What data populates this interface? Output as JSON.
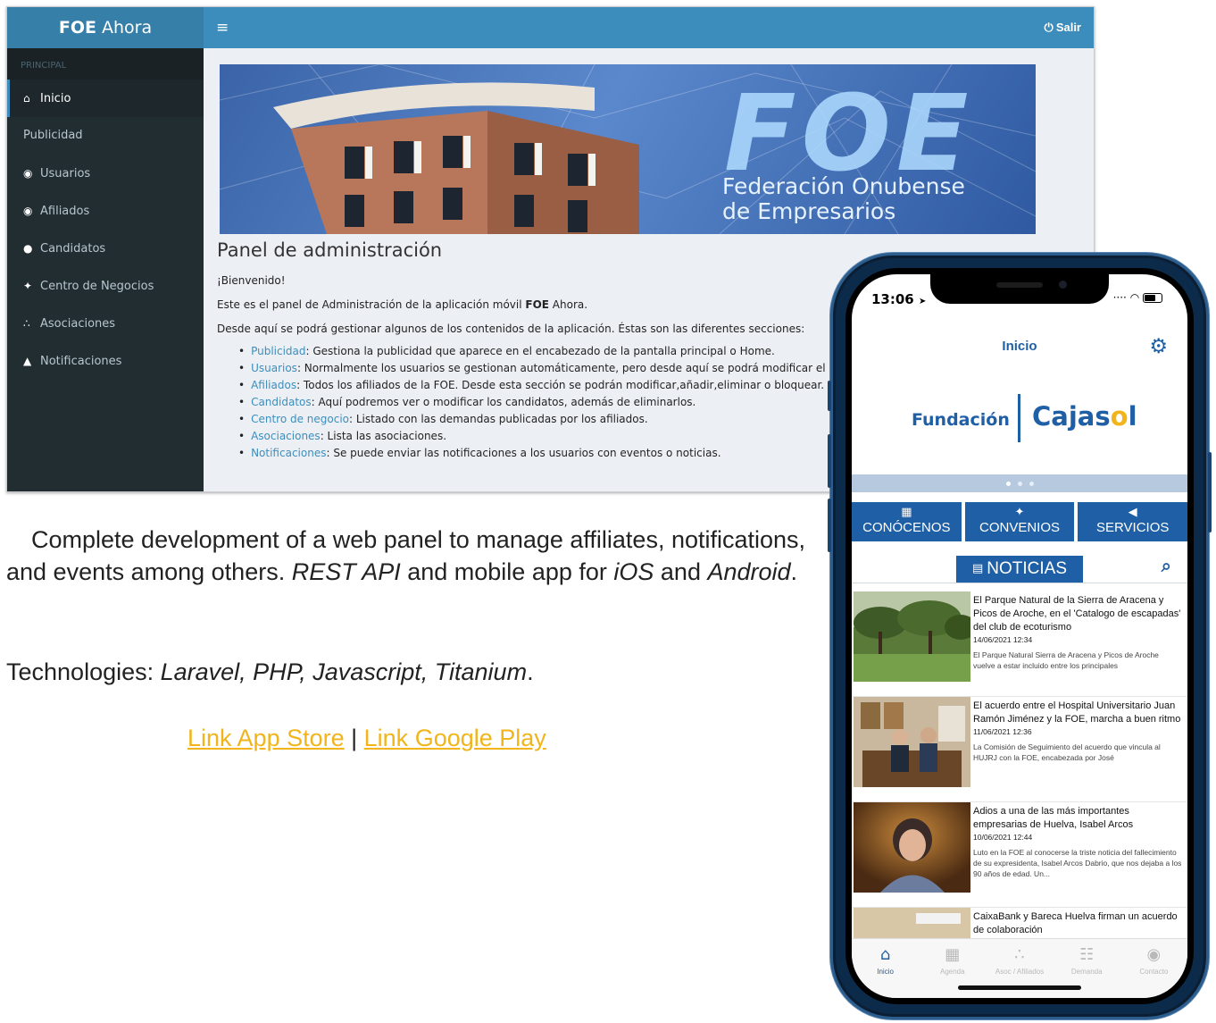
{
  "admin": {
    "brand_bold": "FOE",
    "brand_rest": " Ahora",
    "menu_icon": "≡",
    "logout_icon": "⏻",
    "logout_label": "Salir",
    "sidebar_header": "PRINCIPAL",
    "sidebar": {
      "items": [
        {
          "label": "Inicio",
          "icon": "⌂"
        },
        {
          "label": "Publicidad",
          "icon": ""
        },
        {
          "label": "Usuarios",
          "icon": "◉"
        },
        {
          "label": "Afiliados",
          "icon": "◉"
        },
        {
          "label": "Candidatos",
          "icon": "●"
        },
        {
          "label": "Centro de Negocios",
          "icon": "✦"
        },
        {
          "label": "Asociaciones",
          "icon": "∴"
        },
        {
          "label": "Notificaciones",
          "icon": "▲"
        }
      ]
    },
    "banner": {
      "big": "FOE",
      "line1": "Federación Onubense",
      "line2": "de Empresarios"
    },
    "panel_title": "Panel de administración",
    "welcome": "¡Bienvenido!",
    "intro_pre": "Este es el panel de Administración de la aplicación móvil ",
    "intro_bold": "FOE",
    "intro_post": " Ahora.",
    "sections_intro": "Desde aquí se podrá gestionar algunos de los contenidos de la aplicación. Éstas son las diferentes secciones:",
    "sections": [
      {
        "link": "Publicidad",
        "text": ": Gestiona la publicidad que aparece en el encabezado de la pantalla principal o Home."
      },
      {
        "link": "Usuarios",
        "text": ": Normalmente los usuarios se gestionan automáticamente, pero desde aquí se podrá modificar el correo ele"
      },
      {
        "link": "Afiliados",
        "text": ": Todos los afiliados de la FOE. Desde esta sección se podrán modificar,añadir,eliminar o bloquear."
      },
      {
        "link": "Candidatos",
        "text": ": Aquí podremos ver o modificar los candidatos, además de eliminarlos."
      },
      {
        "link": "Centro de negocio",
        "text": ": Listado con las demandas publicadas por los afiliados."
      },
      {
        "link": "Asociaciones",
        "text": ": Lista las asociaciones."
      },
      {
        "link": "Notificaciones",
        "text": ": Se puede enviar las notificaciones a los usuarios con eventos o noticias."
      }
    ]
  },
  "description": {
    "line_pre": "Complete development of a web panel to manage affiliates, notifications, and events among others. ",
    "rest_api": "REST API",
    "line_mid": " and mobile app for ",
    "ios": "iOS",
    "and": " and ",
    "android": "Android",
    "period": ".",
    "tech_label": "Technologies: ",
    "tech_list": "Laravel, PHP, Javascript, Titanium",
    "link_app_store": "Link App Store",
    "link_sep": " | ",
    "link_google_play": "Link Google Play"
  },
  "phone": {
    "time": "13:06",
    "location_icon": "➤",
    "wifi_icon": "◠",
    "title": "Inicio",
    "gear_icon": "⚙",
    "sponsor_left": "Fundación",
    "sponsor_right_a": "Cajas",
    "sponsor_right_o": "o",
    "sponsor_right_b": "l",
    "tiles": [
      {
        "icon": "▦",
        "label": "CONÓCENOS"
      },
      {
        "icon": "✦",
        "label": "CONVENIOS"
      },
      {
        "icon": "◀",
        "label": "SERVICIOS"
      }
    ],
    "news_tab_icon": "▤",
    "news_tab": "NOTICIAS",
    "search_icon": "⌕",
    "news": [
      {
        "title": "El Parque Natural de la Sierra de Aracena y Picos de Aroche, en el 'Catalogo de escapadas' del club de ecoturismo",
        "date": "14/06/2021 12:34",
        "summary": "El Parque Natural Sierra de Aracena y Picos de Aroche vuelve a estar incluido entre los principales"
      },
      {
        "title": "El acuerdo entre el Hospital Universitario Juan Ramón Jiménez y la FOE, marcha a buen ritmo",
        "date": "11/06/2021 12:36",
        "summary": "La Comisión de Seguimiento del acuerdo que vincula al HUJRJ con la FOE, encabezada por José"
      },
      {
        "title": "Adios a una de las más importantes empresarias de Huelva, Isabel Arcos",
        "date": "10/06/2021 12:44",
        "summary": "Luto en la FOE al conocerse la triste noticia del fallecimiento de su expresidenta, Isabel Arcos Dabrio, que nos dejaba a los 90 años de edad. Un..."
      },
      {
        "title": "CaixaBank y Bareca Huelva firman un acuerdo de colaboración",
        "date": "",
        "summary": ""
      }
    ],
    "tabbar": [
      {
        "icon": "⌂",
        "label": "Inicio"
      },
      {
        "icon": "▦",
        "label": "Agenda"
      },
      {
        "icon": "∴",
        "label": "Asoc / Afiliados"
      },
      {
        "icon": "☷",
        "label": "Demanda"
      },
      {
        "icon": "◉",
        "label": "Contacto"
      }
    ],
    "colors": {
      "primary": "#1f5fa6",
      "accent": "#f1b51b"
    }
  }
}
